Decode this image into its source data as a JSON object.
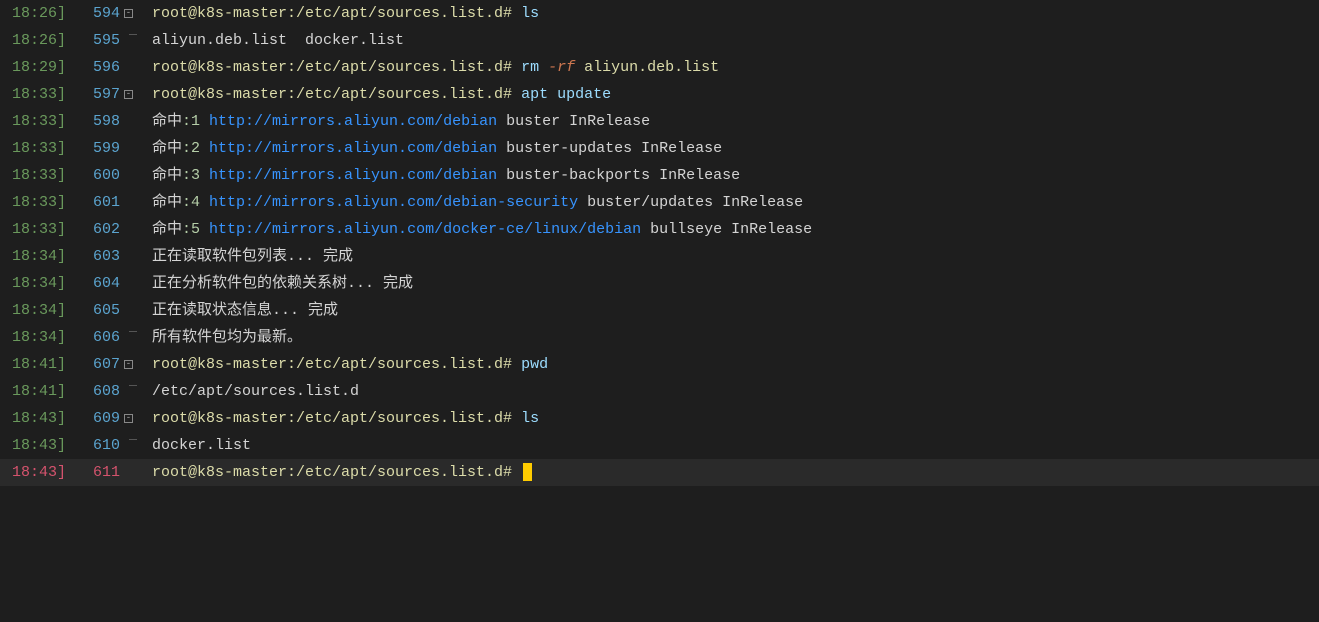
{
  "lines": [
    {
      "ts": "18:26]",
      "ln": "594",
      "fold": "open",
      "tokens": [
        [
          "prompt",
          "root@k8s-master:/etc/apt/sources.list.d# "
        ],
        [
          "cmd",
          "ls"
        ]
      ]
    },
    {
      "ts": "18:26]",
      "ln": "595",
      "fold": "end",
      "tokens": [
        [
          "plain",
          "aliyun.deb.list  docker.list"
        ]
      ]
    },
    {
      "ts": "18:29]",
      "ln": "596",
      "fold": "",
      "tokens": [
        [
          "prompt",
          "root@k8s-master:/etc/apt/sources.list.d# "
        ],
        [
          "cmd",
          "rm "
        ],
        [
          "flag",
          "-rf"
        ],
        [
          "arg",
          " aliyun.deb.list"
        ]
      ]
    },
    {
      "ts": "18:33]",
      "ln": "597",
      "fold": "open",
      "tokens": [
        [
          "prompt",
          "root@k8s-master:/etc/apt/sources.list.d# "
        ],
        [
          "cmd",
          "apt update"
        ]
      ]
    },
    {
      "ts": "18:33]",
      "ln": "598",
      "fold": "guide",
      "tokens": [
        [
          "hit",
          "命中"
        ],
        [
          "num",
          ":1 "
        ],
        [
          "url",
          "http://mirrors.aliyun.com/debian"
        ],
        [
          "tail",
          " buster InRelease"
        ]
      ]
    },
    {
      "ts": "18:33]",
      "ln": "599",
      "fold": "guide",
      "tokens": [
        [
          "hit",
          "命中"
        ],
        [
          "num",
          ":2 "
        ],
        [
          "url",
          "http://mirrors.aliyun.com/debian"
        ],
        [
          "tail",
          " buster-updates InRelease"
        ]
      ]
    },
    {
      "ts": "18:33]",
      "ln": "600",
      "fold": "guide",
      "tokens": [
        [
          "hit",
          "命中"
        ],
        [
          "num",
          ":3 "
        ],
        [
          "url",
          "http://mirrors.aliyun.com/debian"
        ],
        [
          "tail",
          " buster-backports InRelease"
        ]
      ]
    },
    {
      "ts": "18:33]",
      "ln": "601",
      "fold": "guide",
      "tokens": [
        [
          "hit",
          "命中"
        ],
        [
          "num",
          ":4 "
        ],
        [
          "url",
          "http://mirrors.aliyun.com/debian-security"
        ],
        [
          "tail",
          " buster/updates InRelease"
        ]
      ]
    },
    {
      "ts": "18:33]",
      "ln": "602",
      "fold": "guide",
      "tokens": [
        [
          "hit",
          "命中"
        ],
        [
          "num",
          ":5 "
        ],
        [
          "url",
          "http://mirrors.aliyun.com/docker-ce/linux/debian"
        ],
        [
          "tail",
          " bullseye InRelease"
        ]
      ]
    },
    {
      "ts": "18:34]",
      "ln": "603",
      "fold": "guide",
      "tokens": [
        [
          "plain",
          "正在读取软件包列表... 完成"
        ]
      ]
    },
    {
      "ts": "18:34]",
      "ln": "604",
      "fold": "guide",
      "tokens": [
        [
          "plain",
          "正在分析软件包的依赖关系树... 完成"
        ]
      ]
    },
    {
      "ts": "18:34]",
      "ln": "605",
      "fold": "guide",
      "tokens": [
        [
          "plain",
          "正在读取状态信息... 完成"
        ]
      ]
    },
    {
      "ts": "18:34]",
      "ln": "606",
      "fold": "end",
      "tokens": [
        [
          "plain",
          "所有软件包均为最新。"
        ]
      ]
    },
    {
      "ts": "18:41]",
      "ln": "607",
      "fold": "open",
      "tokens": [
        [
          "prompt",
          "root@k8s-master:/etc/apt/sources.list.d# "
        ],
        [
          "cmd",
          "pwd"
        ]
      ]
    },
    {
      "ts": "18:41]",
      "ln": "608",
      "fold": "end",
      "tokens": [
        [
          "plain",
          "/etc/apt/sources.list.d"
        ]
      ]
    },
    {
      "ts": "18:43]",
      "ln": "609",
      "fold": "open",
      "tokens": [
        [
          "prompt",
          "root@k8s-master:/etc/apt/sources.list.d# "
        ],
        [
          "cmd",
          "ls"
        ]
      ]
    },
    {
      "ts": "18:43]",
      "ln": "610",
      "fold": "end",
      "tokens": [
        [
          "plain",
          "docker.list"
        ]
      ]
    },
    {
      "ts": "18:43]",
      "ln": "611",
      "fold": "",
      "active": true,
      "cursor": true,
      "tokens": [
        [
          "prompt",
          "root@k8s-master:/etc/apt/sources.list.d# "
        ]
      ]
    }
  ]
}
